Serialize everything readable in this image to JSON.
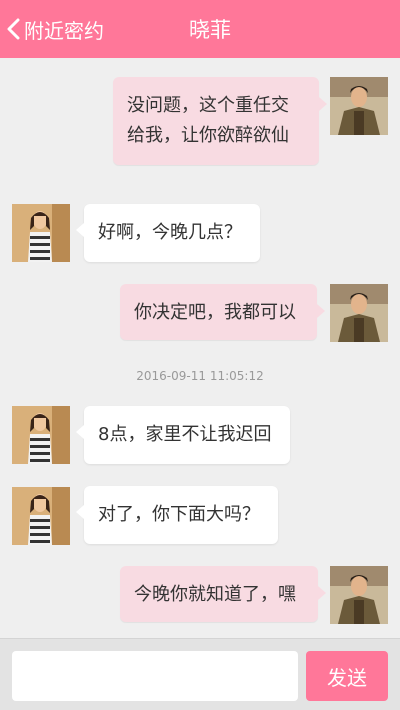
{
  "header": {
    "back_label": "附近密约",
    "title": "晓菲"
  },
  "messages": [
    {
      "from": "me",
      "text": "没问题，这个重任交给我，让你欲醉欲仙"
    },
    {
      "from": "them",
      "text": "好啊，今晚几点？"
    },
    {
      "from": "me",
      "text": "你决定吧，我都可以"
    },
    {
      "timestamp": "2016-09-11 11:05:12"
    },
    {
      "from": "them",
      "text": "8点，家里不让我迟回"
    },
    {
      "from": "them",
      "text": "对了，你下面大吗？"
    },
    {
      "from": "me",
      "text": "今晚你就知道了，嘿"
    }
  ],
  "composer": {
    "input_value": "",
    "send_label": "发送"
  },
  "colors": {
    "accent": "#ff7799",
    "my_bubble": "#f8dbe2",
    "their_bubble": "#ffffff",
    "background": "#efefef"
  }
}
